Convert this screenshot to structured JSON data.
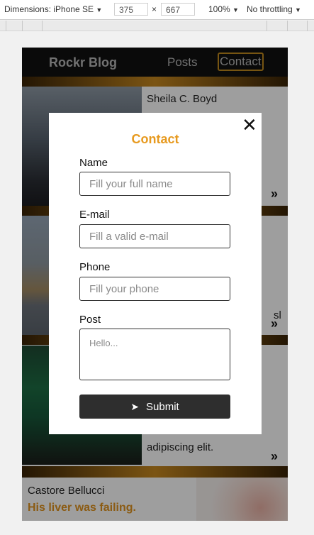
{
  "devtools": {
    "device": "Dimensions: iPhone SE",
    "width": "375",
    "times": "×",
    "height": "667",
    "zoom": "100%",
    "throttle": "No throttling",
    "dropdown_glyph": "▼"
  },
  "site": {
    "brand": "Rockr Blog",
    "nav": {
      "posts": "Posts",
      "contact": "Contact"
    },
    "accent_color": "#e79a1f"
  },
  "posts": [
    {
      "author": "Sheila C. Boyd",
      "arrow": "»"
    },
    {
      "text": "sl",
      "arrow": "»"
    },
    {
      "text": "adipiscing elit.",
      "arrow": "»"
    }
  ],
  "last_post": {
    "author": "Castore Bellucci",
    "title": "His liver was failing."
  },
  "modal": {
    "close_glyph": "✕",
    "title": "Contact",
    "fields": {
      "name": {
        "label": "Name",
        "placeholder": "Fill your full name"
      },
      "email": {
        "label": "E-mail",
        "placeholder": "Fill a valid e-mail"
      },
      "phone": {
        "label": "Phone",
        "placeholder": "Fill your phone"
      },
      "post": {
        "label": "Post",
        "placeholder": "Hello..."
      }
    },
    "submit": {
      "icon": "send-icon",
      "glyph": "➤",
      "label": "Submit"
    }
  }
}
